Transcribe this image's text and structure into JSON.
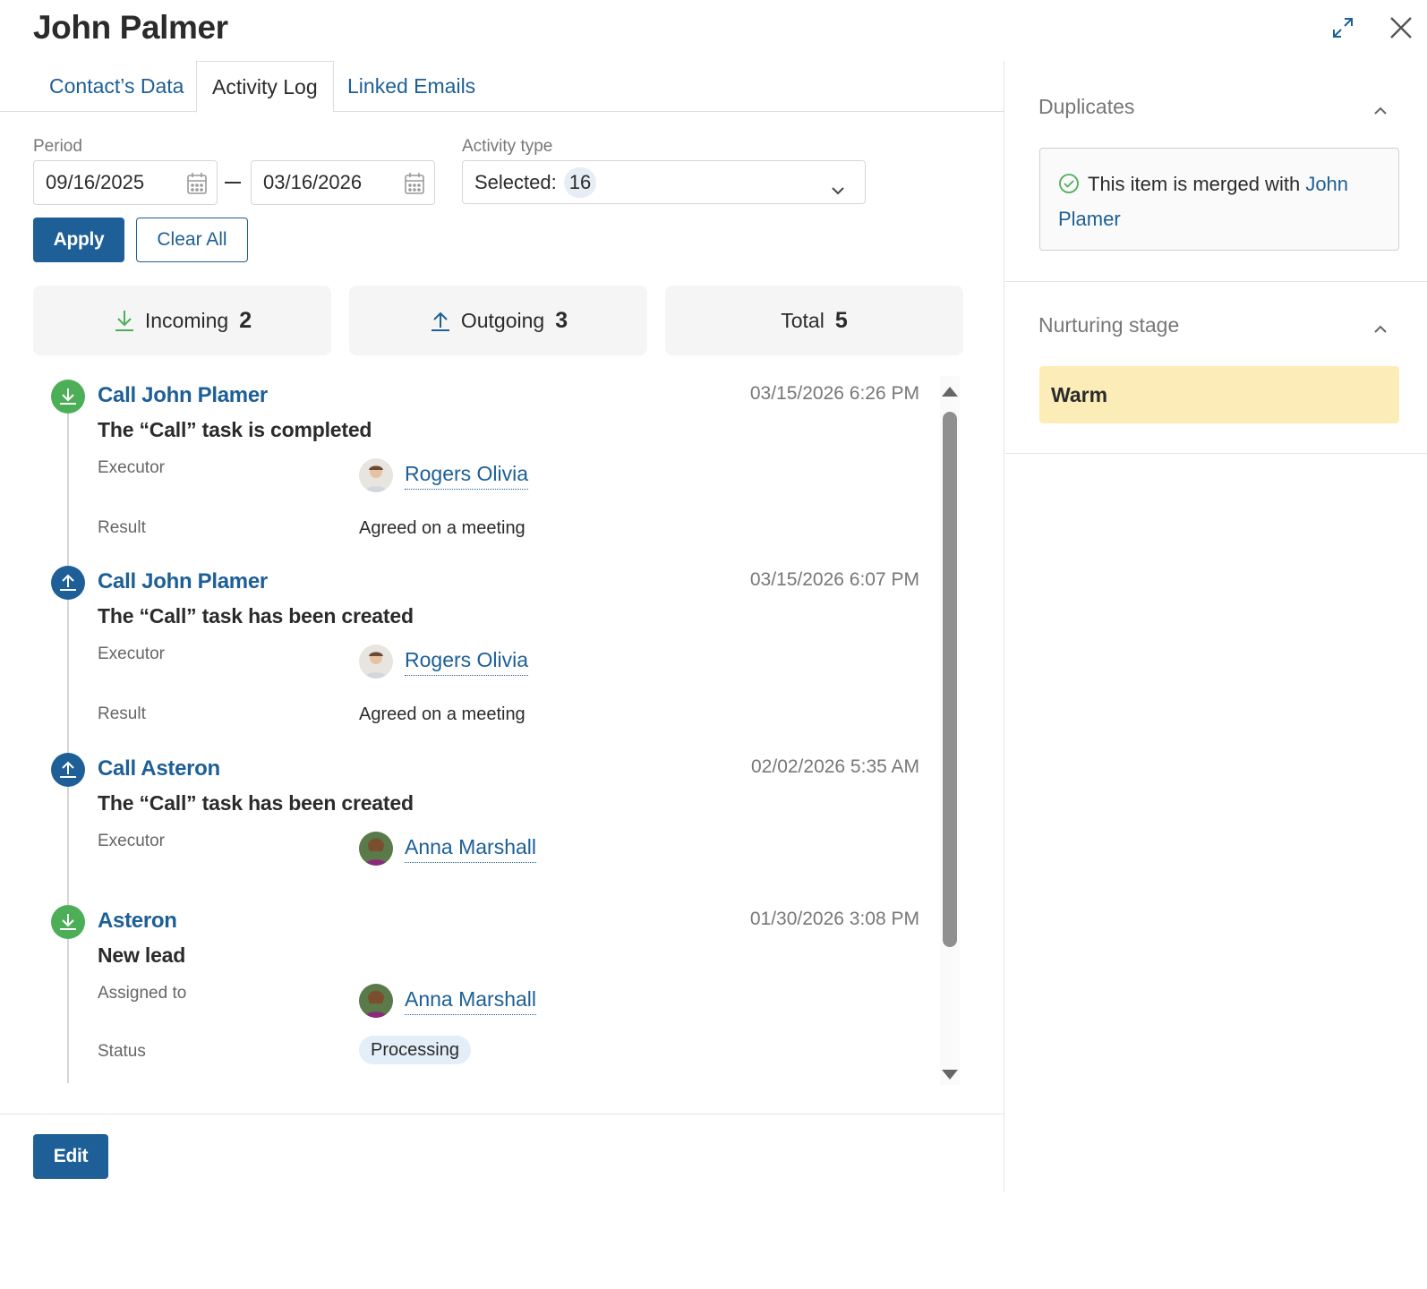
{
  "header": {
    "title": "John Palmer"
  },
  "tabs": [
    {
      "label": "Contact’s Data",
      "active": false
    },
    {
      "label": "Activity Log",
      "active": true
    },
    {
      "label": "Linked Emails",
      "active": false
    }
  ],
  "filters": {
    "period_label": "Period",
    "date_from": "09/16/2025",
    "date_to": "03/16/2026",
    "activity_type_label": "Activity type",
    "selected_label": "Selected:",
    "selected_count": "16",
    "apply_label": "Apply",
    "clear_label": "Clear All"
  },
  "counters": {
    "incoming_label": "Incoming",
    "incoming_count": "2",
    "outgoing_label": "Outgoing",
    "outgoing_count": "3",
    "total_label": "Total",
    "total_count": "5"
  },
  "activities": [
    {
      "direction": "incoming",
      "title": "Call John Plamer",
      "time": "03/15/2026 6:26 PM",
      "description": "The “Call” task is completed",
      "executor_label": "Executor",
      "executor": "Rogers Olivia",
      "result_label": "Result",
      "result": "Agreed on a meeting"
    },
    {
      "direction": "outgoing",
      "title": "Call John Plamer",
      "time": "03/15/2026 6:07 PM",
      "description": "The “Call” task has been created",
      "executor_label": "Executor",
      "executor": "Rogers Olivia",
      "result_label": "Result",
      "result": "Agreed on a meeting"
    },
    {
      "direction": "outgoing",
      "title": "Call Asteron",
      "time": "02/02/2026 5:35 AM",
      "description": "The “Call” task has been created",
      "executor_label": "Executor",
      "executor": "Anna Marshall"
    },
    {
      "direction": "incoming",
      "title": "Asteron",
      "time": "01/30/2026 3:08 PM",
      "description": "New lead",
      "assigned_label": "Assigned to",
      "assigned": "Anna Marshall",
      "status_label": "Status",
      "status": "Processing"
    }
  ],
  "footer": {
    "edit_label": "Edit"
  },
  "sidebar": {
    "duplicates_title": "Duplicates",
    "merged_text": "This item is merged with",
    "merged_link": "John Plamer",
    "nurturing_title": "Nurturing stage",
    "nurturing_value": "Warm"
  },
  "colors": {
    "accent": "#1d5f96",
    "incoming": "#4caf58",
    "stage_warm": "#fcedb8"
  },
  "icons": [
    "expand-icon",
    "close-icon",
    "calendar-icon",
    "chevron-down-icon",
    "download-icon",
    "upload-icon",
    "check-circle-icon",
    "chevron-up-icon"
  ]
}
